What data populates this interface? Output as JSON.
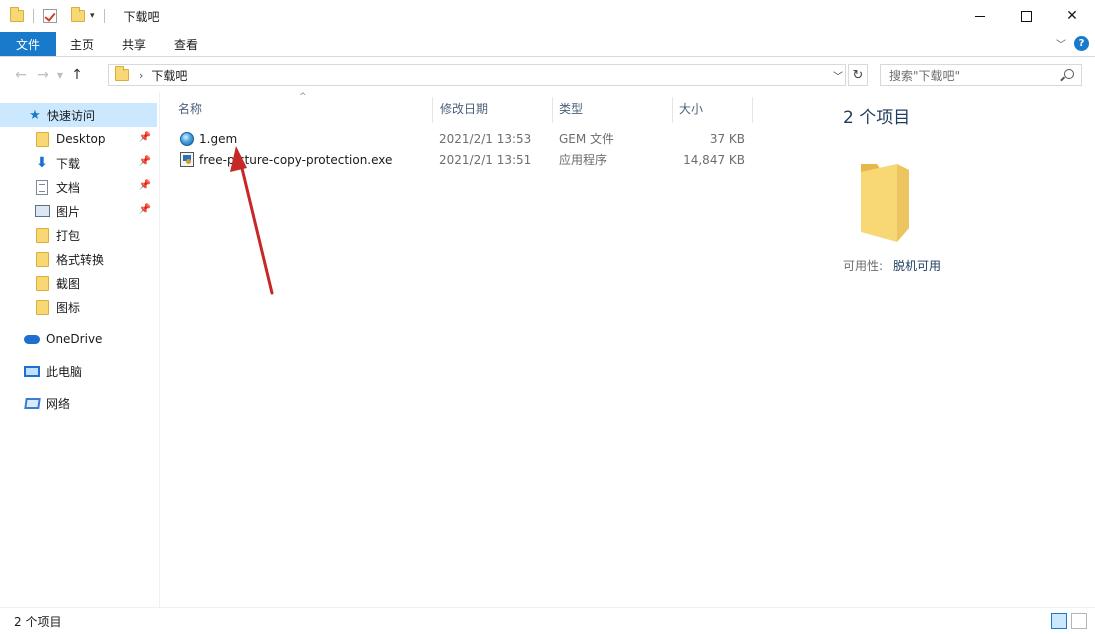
{
  "window": {
    "title": "下载吧",
    "controls": {
      "minimize": "",
      "maximize": "",
      "close": "✕"
    }
  },
  "ribbon": {
    "tabs": [
      "文件",
      "主页",
      "共享",
      "查看"
    ],
    "help": "?"
  },
  "address": {
    "crumb": "下载吧",
    "search_placeholder": "搜索\"下载吧\""
  },
  "sidebar": {
    "quick_access": "快速访问",
    "items": [
      {
        "label": "Desktop",
        "icon": "folder-icon",
        "pinned": true
      },
      {
        "label": "下载",
        "icon": "download-arrow-icon",
        "pinned": true
      },
      {
        "label": "文档",
        "icon": "document-icon",
        "pinned": true
      },
      {
        "label": "图片",
        "icon": "picture-icon",
        "pinned": true
      },
      {
        "label": "打包",
        "icon": "folder-icon",
        "pinned": false
      },
      {
        "label": "格式转换",
        "icon": "folder-icon",
        "pinned": false
      },
      {
        "label": "截图",
        "icon": "folder-icon",
        "pinned": false
      },
      {
        "label": "图标",
        "icon": "folder-icon",
        "pinned": false
      }
    ],
    "onedrive": "OneDrive",
    "this_pc": "此电脑",
    "network": "网络"
  },
  "columns": {
    "name": "名称",
    "modified": "修改日期",
    "type": "类型",
    "size": "大小"
  },
  "files": [
    {
      "name": "1.gem",
      "modified": "2021/2/1 13:53",
      "type": "GEM 文件",
      "size": "37 KB",
      "icon": "gem-file-icon"
    },
    {
      "name": "free-picture-copy-protection.exe",
      "modified": "2021/2/1 13:51",
      "type": "应用程序",
      "size": "14,847 KB",
      "icon": "exe-file-icon"
    }
  ],
  "details": {
    "title": "2 个项目",
    "availability_label": "可用性:",
    "availability_value": "脱机可用"
  },
  "status": {
    "count": "2 个项目"
  },
  "colors": {
    "accent": "#1979ca",
    "selection": "#cce8ff",
    "folder": "#f8d775",
    "annotation_arrow": "#c62828"
  },
  "watermark": "下载吧"
}
